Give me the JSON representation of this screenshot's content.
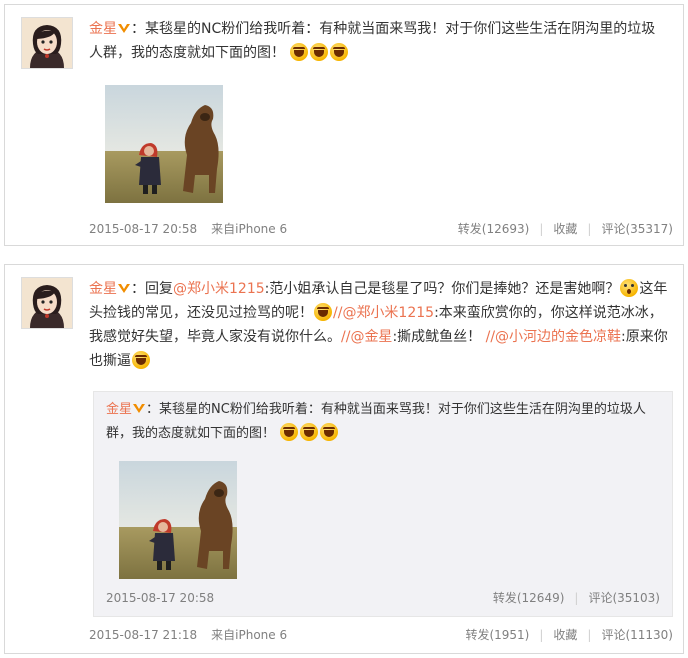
{
  "post1": {
    "author": "金星",
    "text_parts": [
      "：某毯星的NC粉们给我听着：有种就当面来骂我！对于你们这些生活在阴沟里的垃圾人群，我的态度就如下面的图！"
    ],
    "emoji_count": 3,
    "timestamp": "2015-08-17 20:58",
    "source": "来自iPhone 6",
    "repost_label": "转发(12693)",
    "favorite_label": "收藏",
    "comment_label": "评论(35317)"
  },
  "post2": {
    "author": "金星",
    "reply_prefix": "：回复",
    "mention1": "@郑小米1215",
    "text1": ":范小姐承认自己是毯星了吗？你们是捧她？还是害她啊？",
    "text2": "这年头捡钱的常见，还没见过捡骂的呢！",
    "sep1": "//",
    "mention2": "@郑小米1215",
    "text3": ":本来蛮欣赏你的，你这样说范冰冰，我感觉好失望，毕竟人家没有说你什么。",
    "sep2": "//",
    "mention3": "@金星",
    "text4": ":撕成鱿鱼丝！",
    "sep3": "//",
    "mention4": "@小河边的金色凉鞋",
    "text5": ":原来你也撕逼",
    "timestamp": "2015-08-17 21:18",
    "source": "来自iPhone 6",
    "repost_label": "转发(1951)",
    "favorite_label": "收藏",
    "comment_label": "评论(11130)"
  },
  "quoted": {
    "author": "金星",
    "text": "：某毯星的NC粉们给我听着：有种就当面来骂我！对于你们这些生活在阴沟里的垃圾人群，我的态度就如下面的图！",
    "timestamp": "2015-08-17 20:58",
    "repost_label": "转发(12649)",
    "comment_label": "评论(35103)"
  },
  "colors": {
    "link": "#eb7350",
    "meta": "#808080",
    "quote_bg": "#f2f2f5"
  }
}
